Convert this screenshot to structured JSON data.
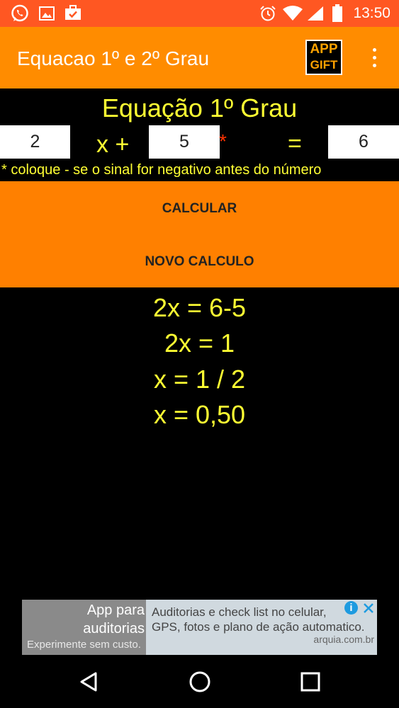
{
  "status_bar": {
    "time": "13:50",
    "left_icons": [
      "whatsapp-icon",
      "image-icon",
      "briefcase-check-icon"
    ],
    "right_icons": [
      "alarm-icon",
      "wifi-icon",
      "signal-icon",
      "battery-icon"
    ]
  },
  "app_bar": {
    "title": "Equacao 1º e 2º Grau",
    "logo_line1": "APP",
    "logo_line2": "GIFT"
  },
  "equation": {
    "title": "Equação 1º Grau",
    "a_value": "2",
    "x_plus_label": "x +",
    "b_value": "5",
    "required_mark": "*",
    "equals_label": "=",
    "c_value": "6",
    "hint": "* coloque - se o sinal for negativo antes do número"
  },
  "actions": {
    "calculate_label": "CALCULAR",
    "new_calc_label": "NOVO CALCULO"
  },
  "result": {
    "lines": [
      "2x = 6-5",
      "2x = 1",
      "x = 1 / 2",
      "x = 0,50"
    ]
  },
  "ad": {
    "title_line1": "App para",
    "title_line2": "auditorias",
    "subtitle": "Experimente sem custo.",
    "text_line1": "Auditorias e check list no celular,",
    "text_line2": "GPS, fotos e plano de ação automatico.",
    "domain": "arquia.com.br",
    "info_glyph": "i"
  },
  "colors": {
    "status_bar": "#ff5722",
    "app_bar": "#ff8c00",
    "accent_text": "#ffff33",
    "action_panel": "#ff8000",
    "background": "#000000"
  }
}
